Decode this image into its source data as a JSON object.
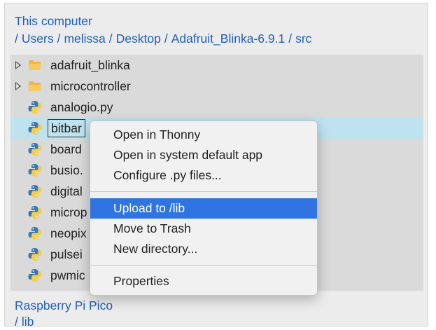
{
  "computer": {
    "title": "This computer",
    "path": [
      "Users",
      "melissa",
      "Desktop",
      "Adafruit_Blinka-6.9.1",
      "src"
    ]
  },
  "tree": {
    "items": [
      {
        "name": "adafruit_blinka",
        "kind": "folder",
        "icon": "folder-icon"
      },
      {
        "name": "microcontroller",
        "kind": "folder",
        "icon": "folder-icon"
      },
      {
        "name": "analogio.py",
        "kind": "file",
        "icon": "python-file-icon"
      },
      {
        "name": "bitbar",
        "kind": "file",
        "icon": "python-file-icon",
        "selected": true
      },
      {
        "name": "board",
        "kind": "file",
        "icon": "python-file-icon"
      },
      {
        "name": "busio.",
        "kind": "file",
        "icon": "python-file-icon"
      },
      {
        "name": "digital",
        "kind": "file",
        "icon": "python-file-icon"
      },
      {
        "name": "microp",
        "kind": "file",
        "icon": "python-file-icon"
      },
      {
        "name": "neopix",
        "kind": "file",
        "icon": "python-file-icon"
      },
      {
        "name": "pulsei",
        "kind": "file",
        "icon": "python-file-icon"
      },
      {
        "name": "pwmic",
        "kind": "file",
        "icon": "python-file-icon"
      }
    ]
  },
  "context_menu": {
    "items": [
      {
        "label": "Open in Thonny"
      },
      {
        "label": "Open in system default app"
      },
      {
        "label": "Configure .py files..."
      },
      {
        "label": "Upload to /lib",
        "highlighted": true
      },
      {
        "label": "Move to Trash"
      },
      {
        "label": "New directory..."
      },
      {
        "label": "Properties"
      }
    ]
  },
  "device": {
    "title": "Raspberry Pi Pico",
    "path": [
      "lib"
    ]
  },
  "colors": {
    "link": "#1f5fbf",
    "selection_row": "#bfe3ee",
    "menu_highlight": "#2f74e0",
    "folder": "#f2b544",
    "python_blue": "#3c77b0",
    "python_yellow": "#f4ce45"
  }
}
